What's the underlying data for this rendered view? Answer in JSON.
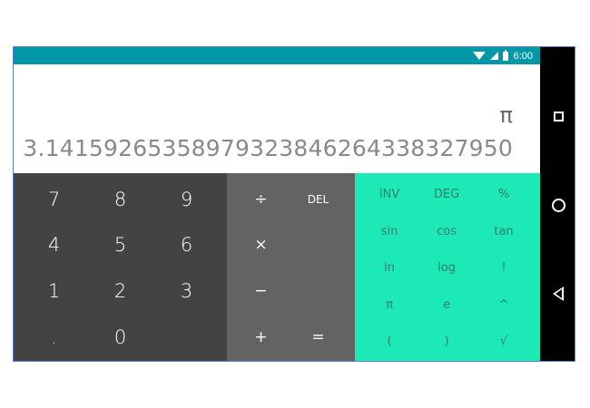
{
  "status_bar": {
    "time": "6:00",
    "icons": [
      "wifi-icon",
      "signal-icon",
      "battery-icon"
    ]
  },
  "display": {
    "formula": "π",
    "result": "3.14159265358979323846264338327950"
  },
  "numpad": {
    "row1": [
      "7",
      "8",
      "9"
    ],
    "row2": [
      "4",
      "5",
      "6"
    ],
    "row3": [
      "1",
      "2",
      "3"
    ],
    "row4": [
      ".",
      "0"
    ]
  },
  "operators": {
    "divide": "÷",
    "delete": "DEL",
    "multiply": "×",
    "minus": "−",
    "plus": "+",
    "equals": "="
  },
  "advanced": {
    "row1": [
      "INV",
      "DEG",
      "%"
    ],
    "row2": [
      "sin",
      "cos",
      "tan"
    ],
    "row3": [
      "ln",
      "log",
      "!"
    ],
    "row4": [
      "π",
      "e",
      "^"
    ],
    "row5": [
      "(",
      ")",
      "√"
    ]
  },
  "colors": {
    "status_bar": "#0097a7",
    "numpad_bg": "#434343",
    "operators_bg": "#636363",
    "advanced_bg": "#1de9b6",
    "advanced_text": "#2f7c6a"
  },
  "nav_bar": {
    "icons": [
      "recent-apps-icon",
      "home-icon",
      "back-icon"
    ]
  }
}
